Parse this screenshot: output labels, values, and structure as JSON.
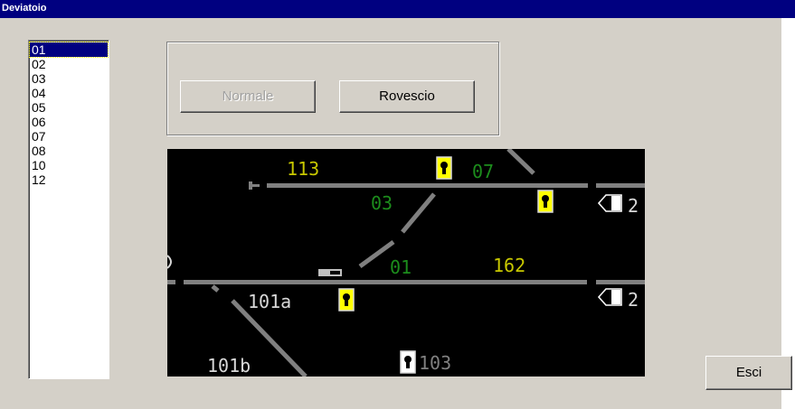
{
  "window": {
    "title": "Deviatoio"
  },
  "list": {
    "items": [
      "01",
      "02",
      "03",
      "04",
      "05",
      "06",
      "07",
      "08",
      "10",
      "12"
    ],
    "selected": "01"
  },
  "buttons": {
    "normale": "Normale",
    "rovescio": "Rovescio",
    "esci": "Esci"
  },
  "diagram": {
    "labels": {
      "l113": "113",
      "l07": "07",
      "l03": "03",
      "l01": "01",
      "l162": "162",
      "l101a": "101a",
      "l101b": "101b",
      "l103": "103",
      "edge_top": "2",
      "edge_mid": "2"
    },
    "colors": {
      "background": "#000000",
      "track": "#808080",
      "track_label": "#d8d8d8",
      "switch_label": "#1c8c1c",
      "section_label": "#c8c800",
      "signal_active": "#ffff00",
      "signal_inactive": "#ffffff"
    }
  }
}
